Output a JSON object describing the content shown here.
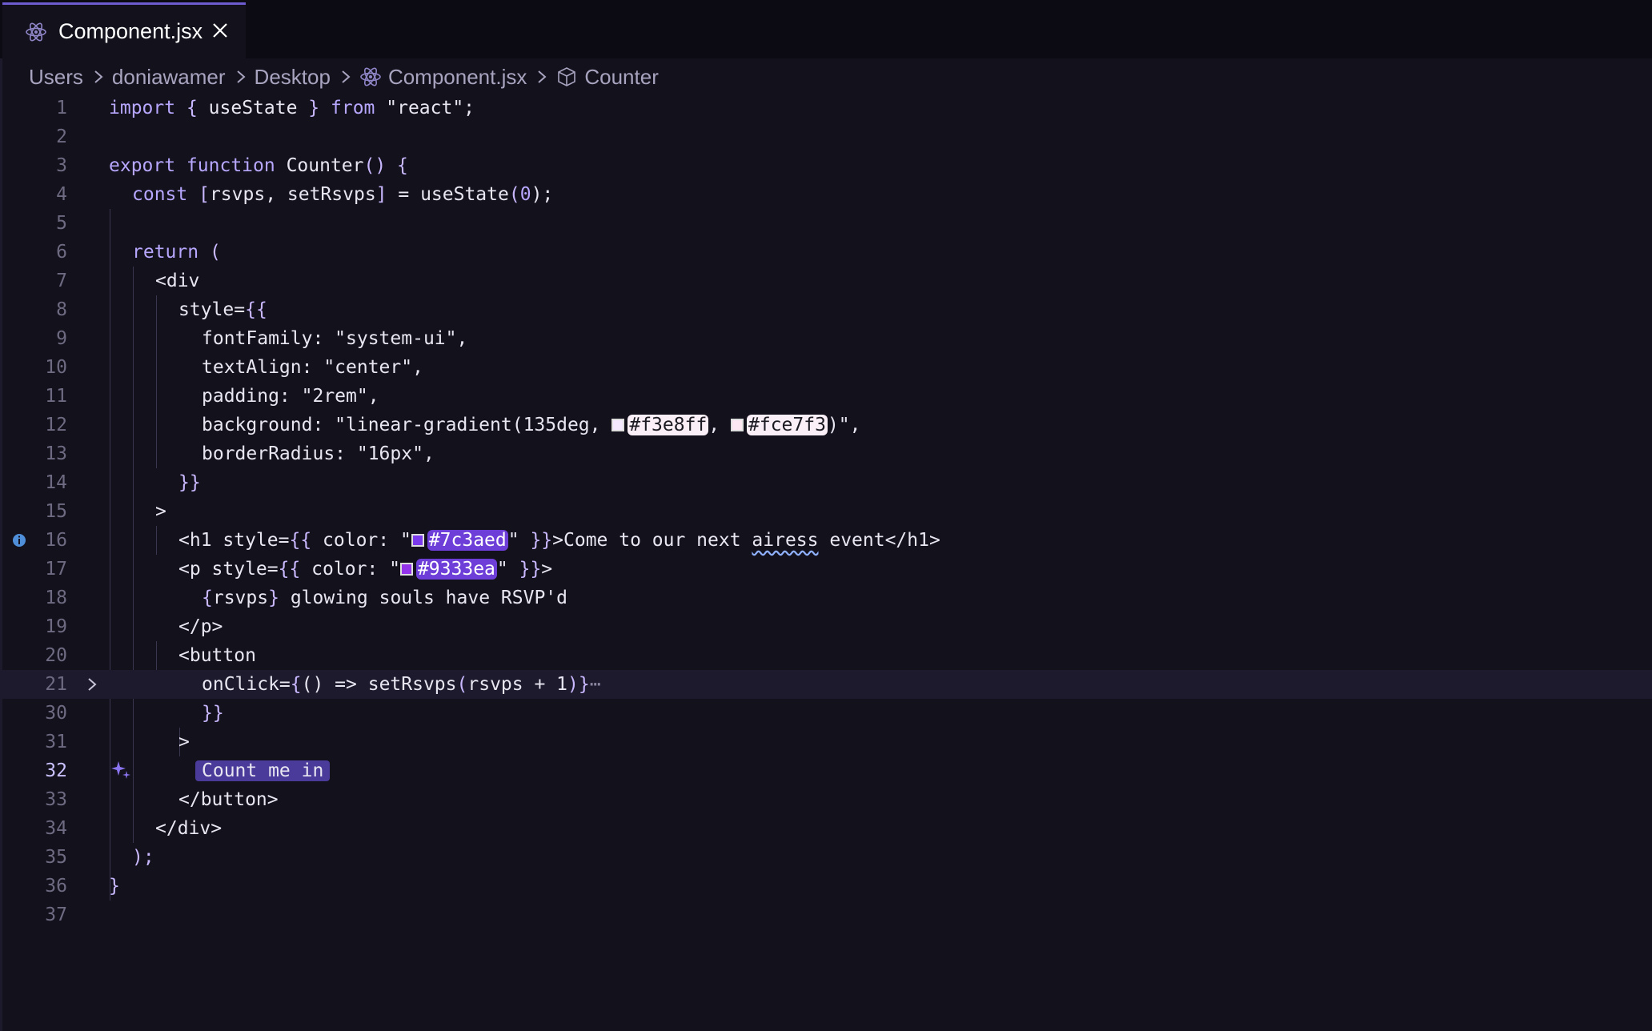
{
  "tab": {
    "label": "Component.jsx"
  },
  "breadcrumb": [
    "Users",
    "doniawamer",
    "Desktop",
    "Component.jsx",
    "Counter"
  ],
  "colors": {
    "accent": "#7c3aed",
    "swatch1": "#f3e8ff",
    "swatch2": "#fce7f3",
    "swatch3": "#7c3aed",
    "swatch4": "#9333ea"
  },
  "gutter": [
    "1",
    "2",
    "3",
    "4",
    "5",
    "6",
    "7",
    "8",
    "9",
    "10",
    "11",
    "12",
    "13",
    "14",
    "15",
    "16",
    "17",
    "18",
    "19",
    "20",
    "21",
    "30",
    "31",
    "32",
    "33",
    "34",
    "35",
    "36",
    "37"
  ],
  "code": {
    "l1a": "import",
    "l1b": "{",
    "l1c": " useState ",
    "l1d": "}",
    "l1e": " from ",
    "l1f": "\"react\";",
    "l3a": "export function",
    "l3b": " Counter",
    "l3c": "()",
    "l3d": " {",
    "l4a": "const",
    "l4b": " [",
    "l4c": "rsvps, setRsvps",
    "l4d": "]",
    "l4e": " = useState",
    "l4f": "(",
    "l4g": "0",
    "l4h": ");",
    "l6a": "return",
    "l6b": " (",
    "l7": "<div",
    "l8a": "style=",
    "l8b": "{{",
    "l9": "fontFamily: \"system-ui\",",
    "l10": "textAlign: \"center\",",
    "l11": "padding: \"2rem\",",
    "l12a": "background: \"linear-gradient(135deg, ",
    "l12b": "#f3e8ff",
    "l12c": ", ",
    "l12d": "#fce7f3",
    "l12e": ")\",",
    "l13": "borderRadius: \"16px\",",
    "l14": "}}",
    "l15": ">",
    "l16a": "<h1 style=",
    "l16b": "{{",
    "l16c": " color: \"",
    "l16d": "#7c3aed",
    "l16e": "\" ",
    "l16f": "}}",
    "l16g": ">Come to our next ",
    "l16h": "airess",
    "l16i": " event</h1>",
    "l17a": "<p style=",
    "l17b": "{{",
    "l17c": " color: \"",
    "l17d": "#9333ea",
    "l17e": "\" ",
    "l17f": "}}",
    "l17g": ">",
    "l18a": "{",
    "l18b": "rsvps",
    "l18c": "}",
    "l18d": " glowing souls have RSVP'd",
    "l19": "</p>",
    "l20": "<button",
    "l21a": "onClick=",
    "l21b": "{",
    "l21c": "() => setRsvps",
    "l21d": "(",
    "l21e": "rsvps + 1",
    "l21f": ")",
    "l21g": "}",
    "l21h": "⋯",
    "l30": "}}",
    "l31": ">",
    "l32": "Count me in",
    "l33": "</button>",
    "l34": "</div>",
    "l35": ");",
    "l36": "}"
  }
}
